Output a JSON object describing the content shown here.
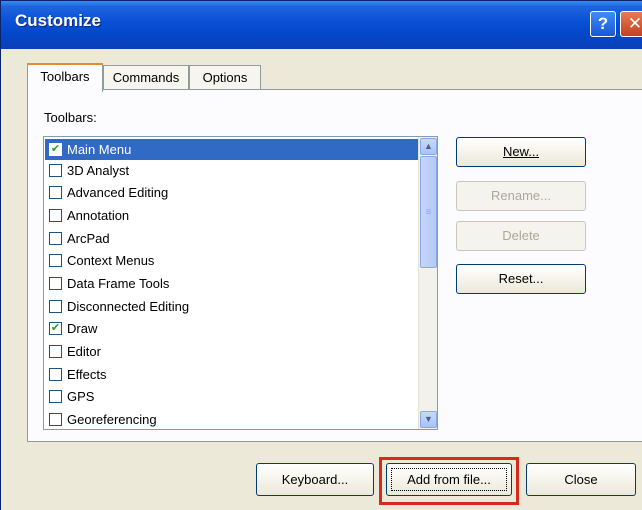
{
  "window": {
    "title": "Customize"
  },
  "titlebar": {
    "help_glyph": "?",
    "close_glyph": "✕"
  },
  "tabs": [
    {
      "label": "Toolbars",
      "selected": true
    },
    {
      "label": "Commands",
      "selected": false
    },
    {
      "label": "Options",
      "selected": false
    }
  ],
  "toolbars_label": "Toolbars:",
  "toolbar_list": [
    {
      "label": "Main Menu",
      "checked": true,
      "selected": true
    },
    {
      "label": "3D Analyst",
      "checked": false
    },
    {
      "label": "Advanced Editing",
      "checked": false
    },
    {
      "label": "Annotation",
      "checked": false
    },
    {
      "label": "ArcPad",
      "checked": false
    },
    {
      "label": "Context Menus",
      "checked": false
    },
    {
      "label": "Data Frame Tools",
      "checked": false
    },
    {
      "label": "Disconnected Editing",
      "checked": false
    },
    {
      "label": "Draw",
      "checked": true
    },
    {
      "label": "Editor",
      "checked": false
    },
    {
      "label": "Effects",
      "checked": false
    },
    {
      "label": "GPS",
      "checked": false
    },
    {
      "label": "Georeferencing",
      "checked": false
    }
  ],
  "side_buttons": {
    "new": "New...",
    "rename": "Rename...",
    "delete": "Delete",
    "reset": "Reset..."
  },
  "bottom_buttons": {
    "keyboard": "Keyboard...",
    "add_from_file": "Add from file...",
    "close": "Close"
  },
  "colors": {
    "title_blue": "#0347c8",
    "selection_blue": "#316ac5",
    "highlight_red": "#d72a1d",
    "dialog_face": "#ECE9D8"
  },
  "icons": {
    "help": "help-icon",
    "close": "close-icon",
    "scroll_up": "chevron-up-icon",
    "scroll_down": "chevron-down-icon",
    "check": "checkmark-icon"
  }
}
